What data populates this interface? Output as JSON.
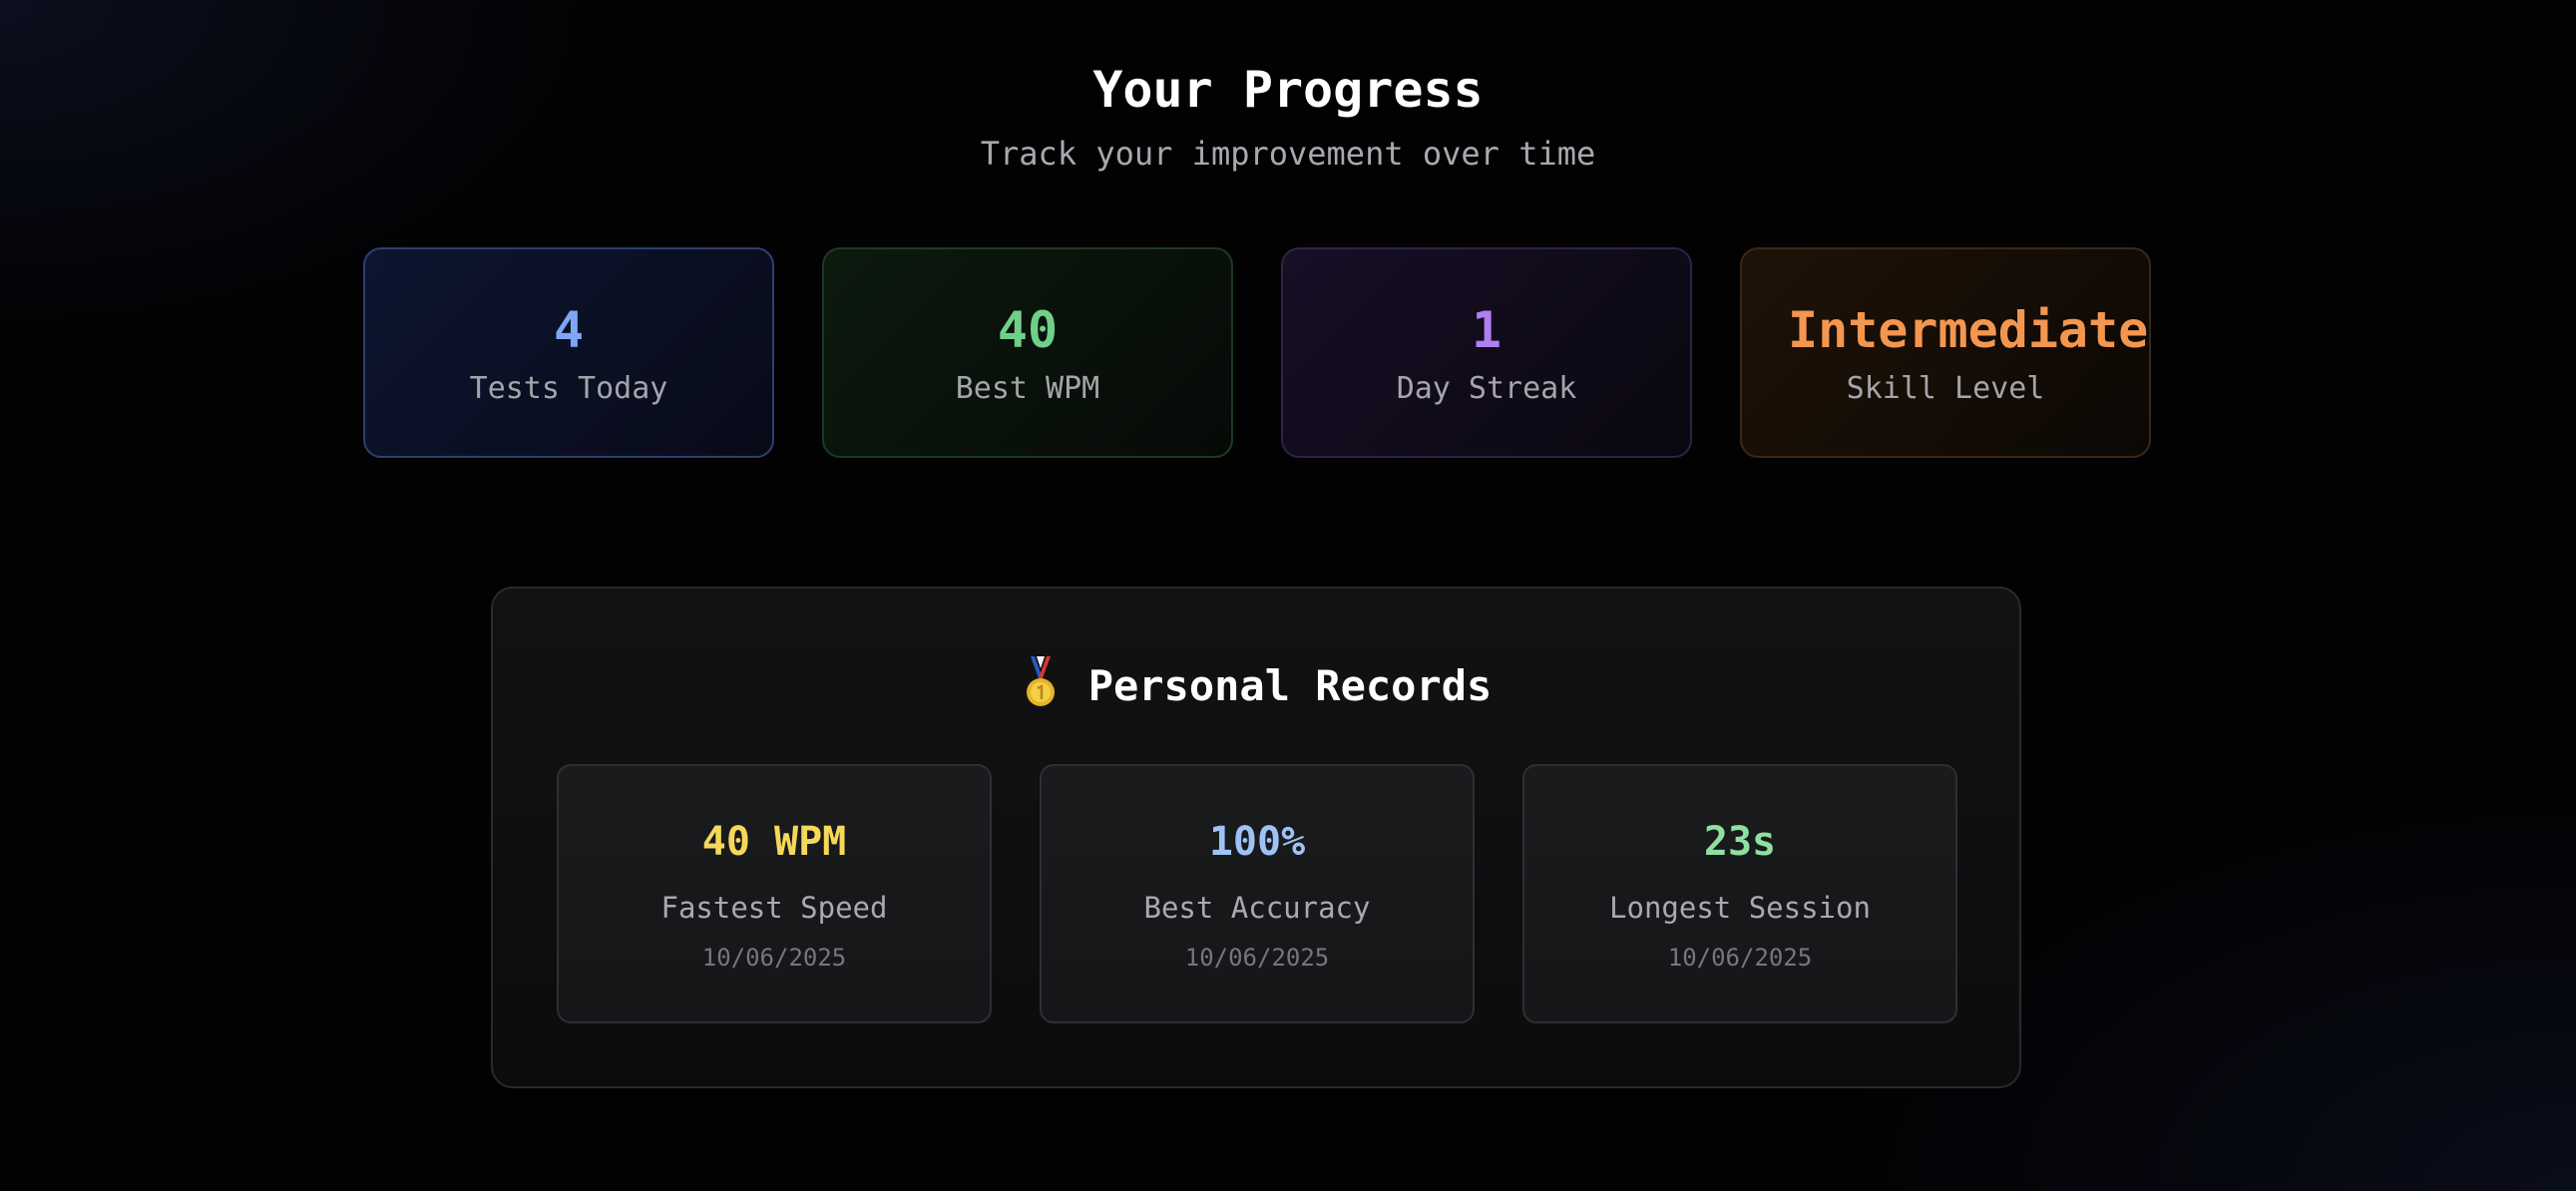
{
  "header": {
    "title": "Your Progress",
    "subtitle": "Track your improvement over time"
  },
  "stats": [
    {
      "value": "4",
      "label": "Tests Today",
      "color": "#7ea6f4"
    },
    {
      "value": "40",
      "label": "Best WPM",
      "color": "#6fd08a"
    },
    {
      "value": "1",
      "label": "Day Streak",
      "color": "#b07ef0"
    },
    {
      "value": "Intermediate",
      "label": "Skill Level",
      "color": "#f39650"
    }
  ],
  "records": {
    "icon": "medal-icon",
    "title": "Personal Records",
    "items": [
      {
        "value": "40 WPM",
        "label": "Fastest Speed",
        "date": "10/06/2025",
        "color": "#f5d85a"
      },
      {
        "value": "100%",
        "label": "Best Accuracy",
        "date": "10/06/2025",
        "color": "#9ec2f6"
      },
      {
        "value": "23s",
        "label": "Longest Session",
        "date": "10/06/2025",
        "color": "#8ee0a0"
      }
    ]
  }
}
